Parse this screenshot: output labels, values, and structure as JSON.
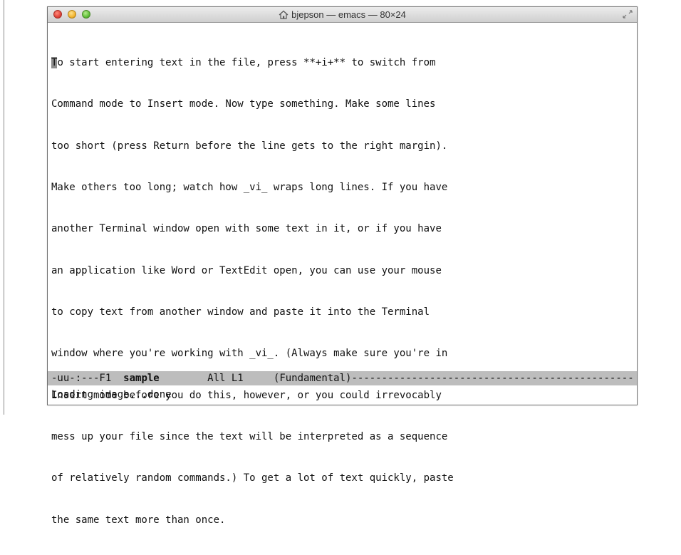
{
  "window": {
    "title": "bjepson — emacs — 80×24"
  },
  "buffer": {
    "cursor_char": "T",
    "first_line_rest": "o start entering text in the file, press **+i+** to switch from",
    "lines": [
      "Command mode to Insert mode. Now type something. Make some lines",
      "too short (press Return before the line gets to the right margin).",
      "Make others too long; watch how _vi_ wraps long lines. If you have",
      "another Terminal window open with some text in it, or if you have",
      "an application like Word or TextEdit open, you can use your mouse",
      "to copy text from another window and paste it into the Terminal",
      "window where you're working with _vi_. (Always make sure you're in",
      "Insert mode before you do this, however, or you could irrevocably",
      "mess up your file since the text will be interpreted as a sequence",
      "of relatively random commands.) To get a lot of text quickly, paste",
      "the same text more than once."
    ]
  },
  "modeline": {
    "status": "-uu-:---F1  ",
    "buffer_name": "sample",
    "position": "        All L1     ",
    "mode": "(Fundamental)",
    "fill": "-----------------------------------------------"
  },
  "echo_area": {
    "message": "Loading image...done"
  }
}
